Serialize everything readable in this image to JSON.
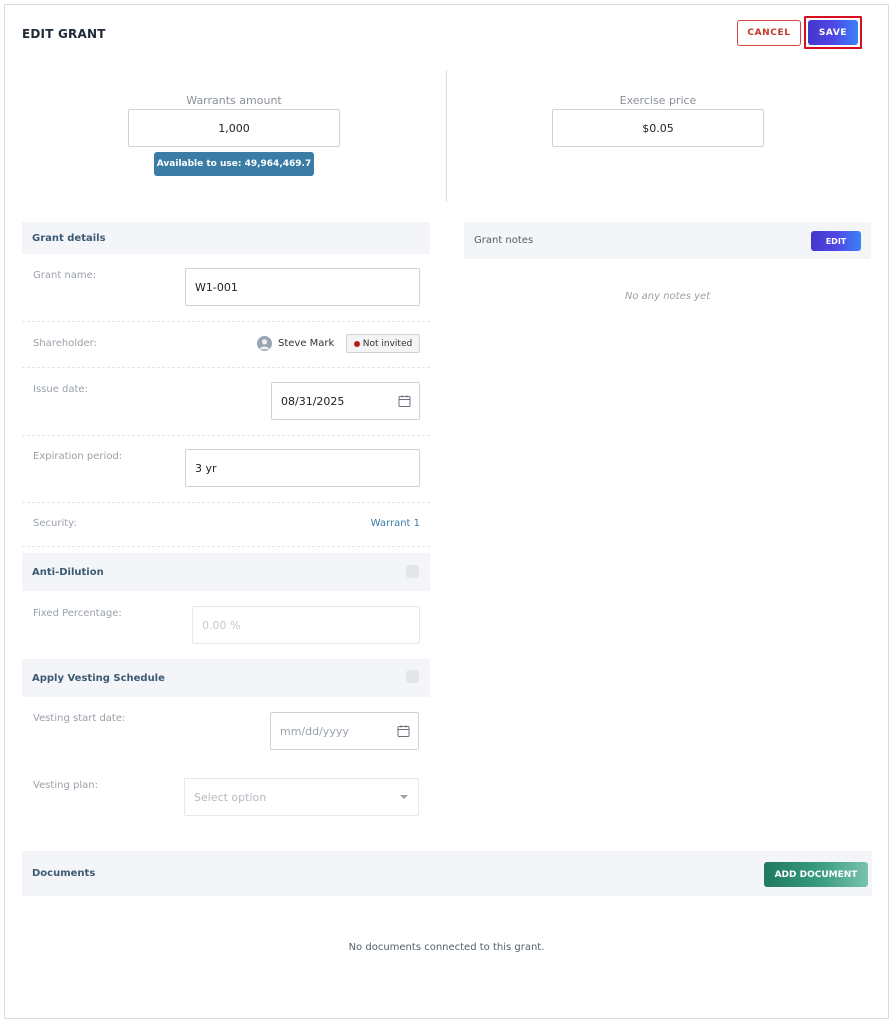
{
  "header": {
    "title": "EDIT GRANT",
    "cancel_label": "CANCEL",
    "save_label": "SAVE"
  },
  "warrants": {
    "label": "Warrants amount",
    "value": "1,000",
    "available": "Available to use: 49,964,469.7"
  },
  "exercise": {
    "label": "Exercise price",
    "value": "$0.05"
  },
  "grant_details": {
    "title": "Grant details",
    "grant_name_label": "Grant name:",
    "grant_name_value": "W1-001",
    "shareholder_label": "Shareholder:",
    "shareholder_name": "Steve Mark",
    "shareholder_status": "Not invited",
    "issue_date_label": "Issue date:",
    "issue_date_value": "08/31/2025",
    "expiration_label": "Expiration period:",
    "expiration_value": "3 yr",
    "security_label": "Security:",
    "security_value": "Warrant 1"
  },
  "anti_dilution": {
    "title": "Anti-Dilution",
    "fixed_label": "Fixed Percentage:",
    "fixed_placeholder": "0.00 %"
  },
  "vesting": {
    "title": "Apply Vesting Schedule",
    "start_label": "Vesting start date:",
    "start_placeholder": "mm/dd/yyyy",
    "plan_label": "Vesting plan:",
    "plan_placeholder": "Select option"
  },
  "notes": {
    "title": "Grant notes",
    "edit_label": "EDIT",
    "empty": "No any notes yet"
  },
  "documents": {
    "title": "Documents",
    "add_label": "ADD DOCUMENT",
    "empty": "No documents connected to this grant."
  },
  "colors": {
    "primary_gradient_start": "#4338ca",
    "primary_gradient_end": "#3b82f6",
    "cancel_red": "#d64545",
    "available_badge": "#3a7ca5",
    "add_document_green": "#1f7a5f",
    "status_not_invited": "#c01818"
  }
}
